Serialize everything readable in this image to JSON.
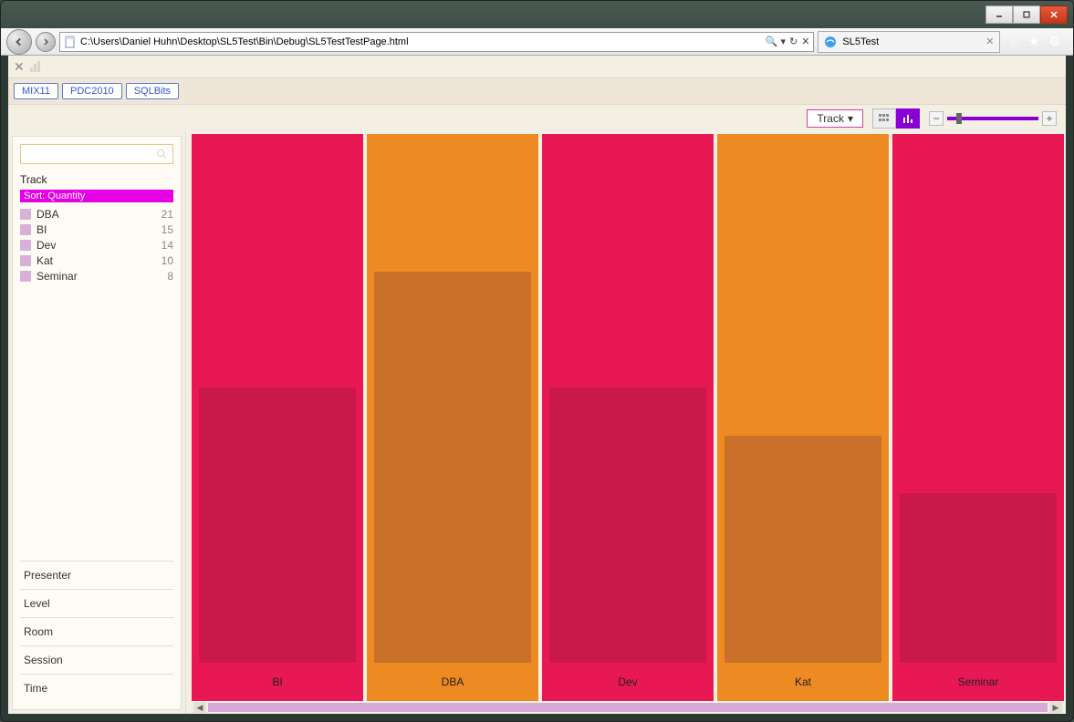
{
  "window": {
    "url": "C:\\Users\\Daniel Huhn\\Desktop\\SL5Test\\Bin\\Debug\\SL5TestTestPage.html",
    "tab_title": "SL5Test"
  },
  "filters": [
    "MIX11",
    "PDC2010",
    "SQLBits"
  ],
  "options": {
    "group_label": "Track"
  },
  "sidebar": {
    "category_title": "Track",
    "sort_label": "Sort: Quantity",
    "items": [
      {
        "label": "DBA",
        "count": "21"
      },
      {
        "label": "BI",
        "count": "15"
      },
      {
        "label": "Dev",
        "count": "14"
      },
      {
        "label": "Kat",
        "count": "10"
      },
      {
        "label": "Seminar",
        "count": "8"
      }
    ],
    "footers": [
      "Presenter",
      "Level",
      "Room",
      "Session",
      "Time"
    ]
  },
  "chart_data": {
    "type": "bar",
    "title": "",
    "xlabel": "",
    "ylabel": "",
    "categories": [
      "BI",
      "DBA",
      "Dev",
      "Kat",
      "Seminar"
    ],
    "series": [
      {
        "name": "background",
        "values": [
          21,
          21,
          21,
          21,
          21
        ]
      },
      {
        "name": "quantity",
        "values": [
          15,
          21,
          14,
          10,
          8
        ]
      }
    ],
    "ylim": [
      0,
      21
    ],
    "colors": {
      "bg": [
        "#e81854",
        "#ee8a22",
        "#e81854",
        "#ee8a22",
        "#e81854"
      ],
      "fg": [
        "#c9184a",
        "#c9702a",
        "#c9184a",
        "#c9702a",
        "#c9184a"
      ],
      "label_bg": [
        "#e81854",
        "#ee8a22",
        "#e81854",
        "#ee8a22",
        "#e81854"
      ],
      "fg_height_pct": [
        52,
        74,
        52,
        43,
        32
      ]
    }
  }
}
